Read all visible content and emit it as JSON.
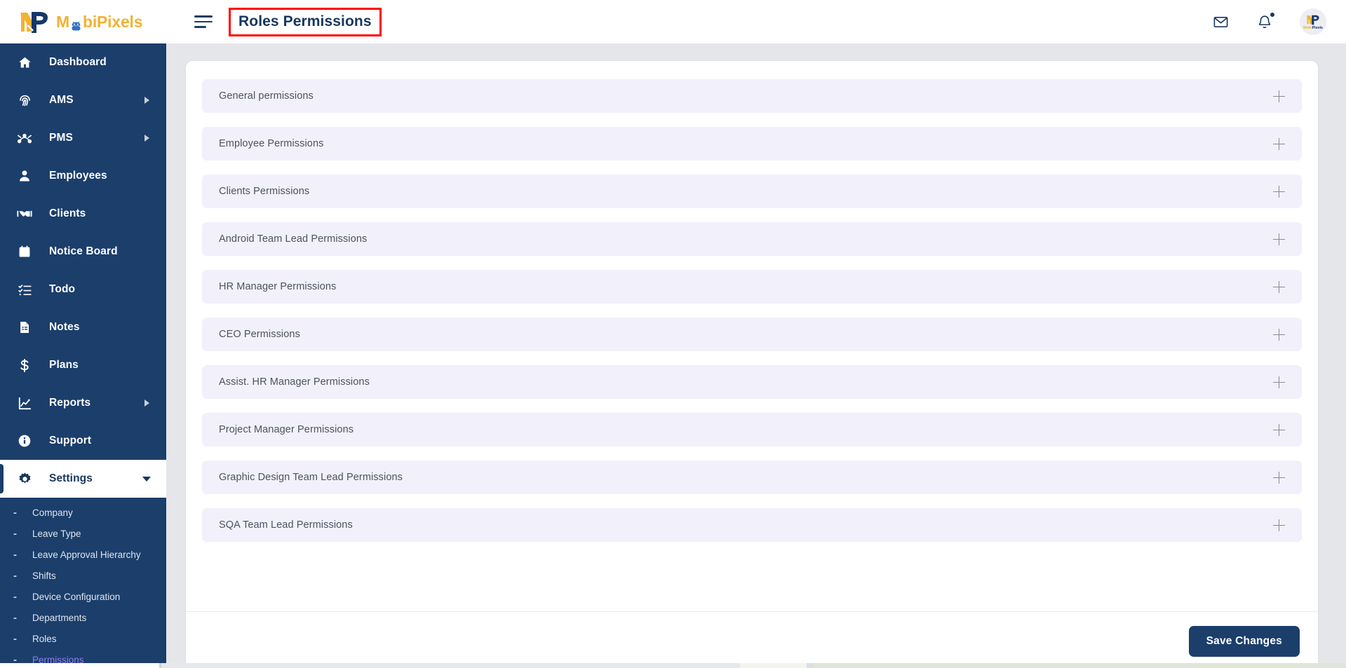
{
  "brand": {
    "logo_text_part1": "M",
    "logo_text_part2": "bi",
    "logo_text_part3": "Pixels",
    "avatar_label_part1": "Mobi",
    "avatar_label_part2": "Pixels",
    "navy": "#1b3e6b",
    "gold": "#f2b233",
    "accent_active": "#8d7cf0",
    "row_bg": "#f2f0fa",
    "annotation_red": "#ff0000"
  },
  "header": {
    "page_title": "Roles Permissions",
    "menu_toggle": "menu-toggle",
    "mail_icon": "mail-icon",
    "bell_icon": "bell-icon",
    "avatar": "user-avatar"
  },
  "sidebar": {
    "items": [
      {
        "label": "Dashboard",
        "icon": "home-icon",
        "has_arrow": false,
        "active": false
      },
      {
        "label": "AMS",
        "icon": "fingerprint-icon",
        "has_arrow": true,
        "active": false
      },
      {
        "label": "PMS",
        "icon": "network-nodes-icon",
        "has_arrow": true,
        "active": false
      },
      {
        "label": "Employees",
        "icon": "user-icon",
        "has_arrow": false,
        "active": false
      },
      {
        "label": "Clients",
        "icon": "handshake-icon",
        "has_arrow": false,
        "active": false
      },
      {
        "label": "Notice Board",
        "icon": "calendar-icon",
        "has_arrow": false,
        "active": false
      },
      {
        "label": "Todo",
        "icon": "checklist-icon",
        "has_arrow": false,
        "active": false
      },
      {
        "label": "Notes",
        "icon": "document-icon",
        "has_arrow": false,
        "active": false
      },
      {
        "label": "Plans",
        "icon": "dollar-icon",
        "has_arrow": false,
        "active": false
      },
      {
        "label": "Reports",
        "icon": "chart-line-icon",
        "has_arrow": true,
        "active": false
      },
      {
        "label": "Support",
        "icon": "info-circle-icon",
        "has_arrow": false,
        "active": false
      },
      {
        "label": "Settings",
        "icon": "gear-icon",
        "has_arrow": false,
        "active": true
      }
    ],
    "settings_submenu": [
      {
        "label": "Company",
        "active": false
      },
      {
        "label": "Leave Type",
        "active": false
      },
      {
        "label": "Leave Approval Hierarchy",
        "active": false
      },
      {
        "label": "Shifts",
        "active": false
      },
      {
        "label": "Device Configuration",
        "active": false
      },
      {
        "label": "Departments",
        "active": false
      },
      {
        "label": "Roles",
        "active": false
      },
      {
        "label": "Permissions",
        "active": true
      }
    ]
  },
  "main": {
    "permission_groups": [
      {
        "label": "General permissions",
        "expanded": false,
        "toggle": "plus-icon"
      },
      {
        "label": "Employee Permissions",
        "expanded": false,
        "toggle": "plus-icon"
      },
      {
        "label": "Clients Permissions",
        "expanded": false,
        "toggle": "plus-icon"
      },
      {
        "label": "Android Team Lead Permissions",
        "expanded": false,
        "toggle": "plus-icon"
      },
      {
        "label": "HR Manager Permissions",
        "expanded": false,
        "toggle": "plus-icon"
      },
      {
        "label": "CEO Permissions",
        "expanded": false,
        "toggle": "plus-icon"
      },
      {
        "label": "Assist. HR Manager Permissions",
        "expanded": false,
        "toggle": "plus-icon"
      },
      {
        "label": "Project Manager Permissions",
        "expanded": false,
        "toggle": "plus-icon"
      },
      {
        "label": "Graphic Design Team Lead Permissions",
        "expanded": false,
        "toggle": "plus-icon"
      },
      {
        "label": "SQA Team Lead Permissions",
        "expanded": false,
        "toggle": "plus-icon"
      }
    ],
    "save_button": "Save Changes"
  }
}
